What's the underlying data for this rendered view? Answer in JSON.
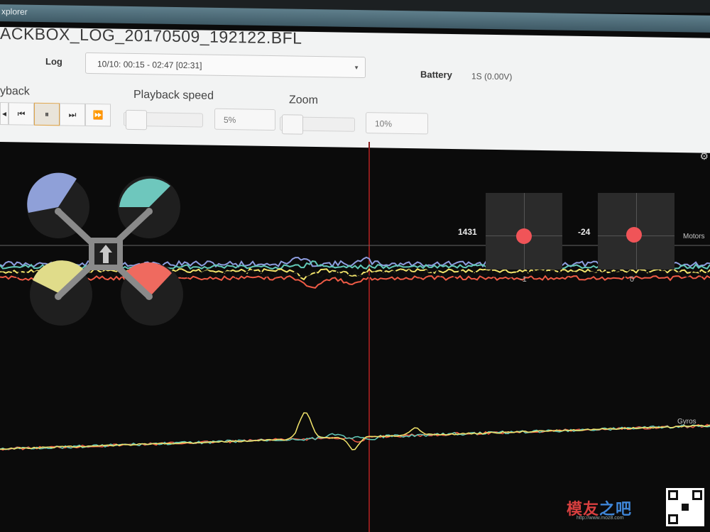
{
  "window": {
    "title": "xplorer"
  },
  "header": {
    "filename": "ACKBOX_LOG_20170509_192122.BFL",
    "log_label": "Log",
    "log_selected": "10/10: 00:15 - 02:47 [02:31]",
    "battery_label": "Battery",
    "battery_value": "1S (0.00V)"
  },
  "playback": {
    "label": "yback",
    "speed_label": "Playback speed",
    "speed_value": "5%",
    "zoom_label": "Zoom",
    "zoom_value": "10%",
    "buttons": [
      "rewind-icon",
      "step-back-icon",
      "pause-icon",
      "step-forward-icon",
      "fast-forward-icon"
    ]
  },
  "sticks": {
    "left": {
      "left_value": "1431",
      "bottom_value": "-1"
    },
    "right": {
      "left_value": "-24",
      "bottom_value": "0"
    }
  },
  "series_labels": {
    "motors": "Motors",
    "gyros": "Gyros"
  },
  "colors": {
    "motor1": "#8fa0d8",
    "motor2": "#6ec7bd",
    "motor3": "#e0dc8a",
    "motor4": "#ef6a5f",
    "trace_red": "#ef5b46",
    "trace_yellow": "#f2e46b",
    "trace_blue": "#8e9ee0",
    "trace_teal": "#62c9b8",
    "cursor": "#8c1c1c"
  },
  "watermark": {
    "text_a": "模友",
    "text_b": "之吧",
    "url": "http://www.moz8.com"
  }
}
